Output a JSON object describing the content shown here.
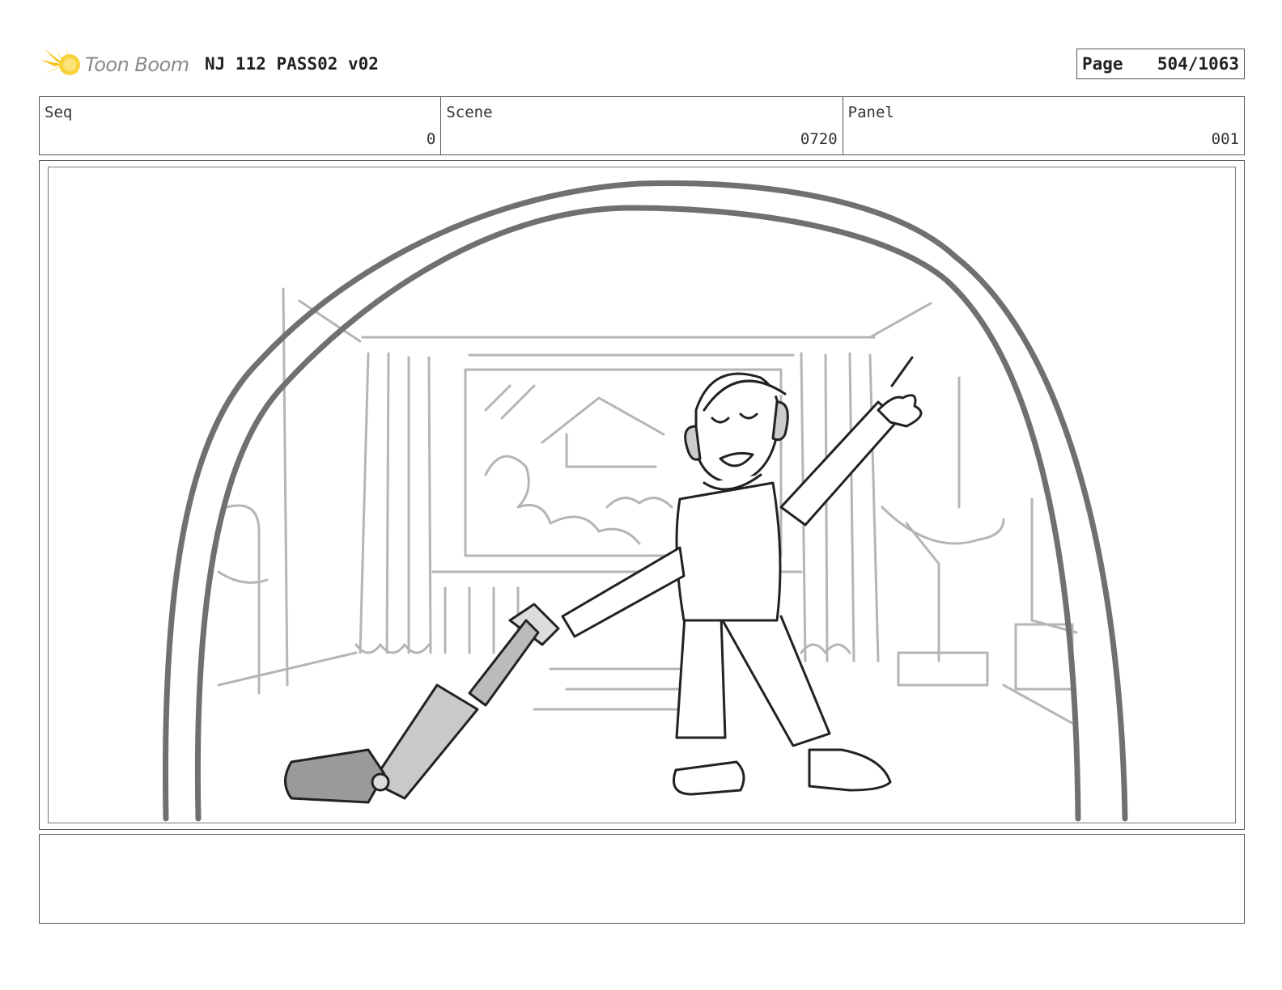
{
  "header": {
    "logo_text": "Toon Boom",
    "title": "NJ 112 PASS02 v02",
    "page_label": "Page",
    "page_value": "504/1063"
  },
  "info": {
    "seq": {
      "label": "Seq",
      "value": "0"
    },
    "scene": {
      "label": "Scene",
      "value": "0720"
    },
    "panel": {
      "label": "Panel",
      "value": "001"
    }
  },
  "notes": {
    "text": ""
  },
  "colors": {
    "logo_accent": "#f5c518",
    "line": "#555555",
    "sketch_light": "#b5b5b5",
    "sketch_dark": "#707070"
  }
}
